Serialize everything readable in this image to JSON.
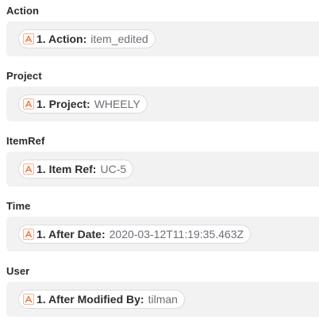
{
  "fields": [
    {
      "label": "Action",
      "pill": {
        "icon": "app-logo-icon",
        "key": "1. Action:",
        "value": "item_edited"
      }
    },
    {
      "label": "Project",
      "pill": {
        "icon": "app-logo-icon",
        "key": "1. Project:",
        "value": "WHEELY"
      }
    },
    {
      "label": "ItemRef",
      "pill": {
        "icon": "app-logo-icon",
        "key": "1. Item Ref:",
        "value": "UC-5"
      }
    },
    {
      "label": "Time",
      "pill": {
        "icon": "app-logo-icon",
        "key": "1. After Date:",
        "value": "2020-03-12T11:19:35.463Z"
      }
    },
    {
      "label": "User",
      "pill": {
        "icon": "app-logo-icon",
        "key": "1. After Modified By:",
        "value": "tilman"
      }
    }
  ],
  "colors": {
    "icon_accent": "#e8703a",
    "field_background": "#f2f2f3",
    "pill_border": "#dcdcdf",
    "value_text": "#6b6f75"
  }
}
